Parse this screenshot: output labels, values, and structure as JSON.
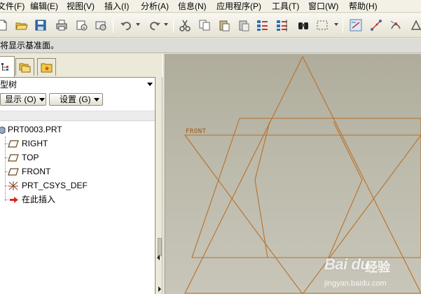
{
  "menubar": {
    "items": [
      {
        "label": "文件(F)"
      },
      {
        "label": "编辑(E)"
      },
      {
        "label": "视图(V)"
      },
      {
        "label": "插入(I)"
      },
      {
        "label": "分析(A)"
      },
      {
        "label": "信息(N)"
      },
      {
        "label": "应用程序(P)"
      },
      {
        "label": "工具(T)"
      },
      {
        "label": "窗口(W)"
      },
      {
        "label": "帮助(H)"
      }
    ]
  },
  "toolbar": {
    "icons": [
      "new-icon",
      "open-icon",
      "save-icon",
      "print-icon",
      "send-icon",
      "close-window-icon",
      "undo-icon",
      "redo-icon",
      "cut-icon",
      "copy-icon",
      "paste-icon",
      "paste-special-icon",
      "regenerate-icon",
      "regenerate-manager-icon",
      "find-icon",
      "select-box-icon",
      "datum-display-icon",
      "axis-display-icon",
      "point-display-icon",
      "csys-display-icon"
    ]
  },
  "message": {
    "text": "将显示基准面。"
  },
  "navigator": {
    "tabs": [
      {
        "icon": "model-tree-icon"
      },
      {
        "icon": "folder-browser-icon"
      },
      {
        "icon": "favorites-icon"
      }
    ]
  },
  "model_tree": {
    "title": "型树",
    "show_button": "显示 (O)",
    "settings_button": "设置 (G)",
    "items": [
      {
        "label": "PRT0003.PRT",
        "icon": "part-icon"
      },
      {
        "label": "RIGHT",
        "icon": "datum-plane-icon"
      },
      {
        "label": "TOP",
        "icon": "datum-plane-icon"
      },
      {
        "label": "FRONT",
        "icon": "datum-plane-icon"
      },
      {
        "label": "PRT_CSYS_DEF",
        "icon": "csys-icon"
      },
      {
        "label": "在此插入",
        "icon": "insert-here-arrow-icon"
      }
    ]
  },
  "graphics": {
    "datum_label": "FRONT",
    "line_color": "#b8712c"
  },
  "watermark": {
    "brand": "Bai du",
    "brand_cn": "经验",
    "url": "jingyan.baidu.com"
  },
  "colors": {
    "accent": "#b8712c",
    "toolbar_bg": "#ece9d8",
    "graphics_bg": "#bcbaab"
  }
}
